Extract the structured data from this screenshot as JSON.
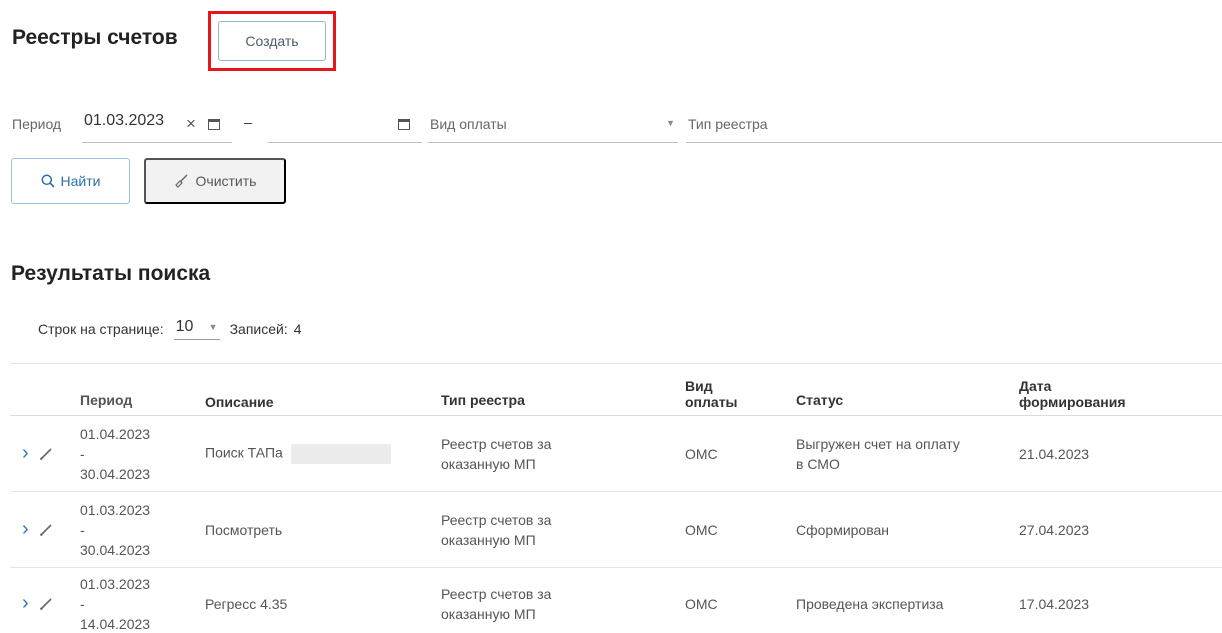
{
  "header": {
    "title": "Реестры счетов",
    "create_label": "Создать"
  },
  "filters": {
    "period_label": "Период",
    "period_from": "01.03.2023",
    "period_sep": "–",
    "payment_type_placeholder": "Вид оплаты",
    "registry_type_placeholder": "Тип реестра"
  },
  "actions": {
    "find_label": "Найти",
    "clear_label": "Очистить"
  },
  "results": {
    "title": "Результаты поиска",
    "rows_per_page_label": "Строк на странице:",
    "rows_per_page": "10",
    "records_label": "Записей:",
    "records_count": "4"
  },
  "table": {
    "headers": {
      "period": "Период",
      "description": "Описание",
      "registry_type": "Тип реестра",
      "payment_type_1": "Вид",
      "payment_type_2": "оплаты",
      "status": "Статус",
      "date_1": "Дата",
      "date_2": "формирования"
    },
    "rows": [
      {
        "period_from": "01.04.2023",
        "dash": "-",
        "period_to": "30.04.2023",
        "description": "Поиск ТАПа",
        "type_1": "Реестр счетов за",
        "type_2": "оказанную МП",
        "payment": "ОМС",
        "status_1": "Выгружен счет на оплату",
        "status_2": "в СМО",
        "date": "21.04.2023"
      },
      {
        "period_from": "01.03.2023",
        "dash": "-",
        "period_to": "30.04.2023",
        "description": "Посмотреть",
        "type_1": "Реестр счетов за",
        "type_2": "оказанную МП",
        "payment": "ОМС",
        "status_1": "Сформирован",
        "status_2": "",
        "date": "27.04.2023"
      },
      {
        "period_from": "01.03.2023",
        "dash": "-",
        "period_to": "14.04.2023",
        "description": "Регресс 4.35",
        "type_1": "Реестр счетов за",
        "type_2": "оказанную МП",
        "payment": "ОМС",
        "status_1": "Проведена экспертиза",
        "status_2": "",
        "date": "17.04.2023"
      }
    ]
  },
  "icons": {
    "clear_x": "close-icon",
    "calendar": "calendar-icon",
    "dropdown": "chevron-down-icon",
    "search": "search-icon",
    "broom": "broom-icon",
    "expand": "chevron-right-icon",
    "edit": "pencil-icon"
  },
  "colors": {
    "highlight": "#e8141e",
    "accent": "#2c78c0"
  }
}
